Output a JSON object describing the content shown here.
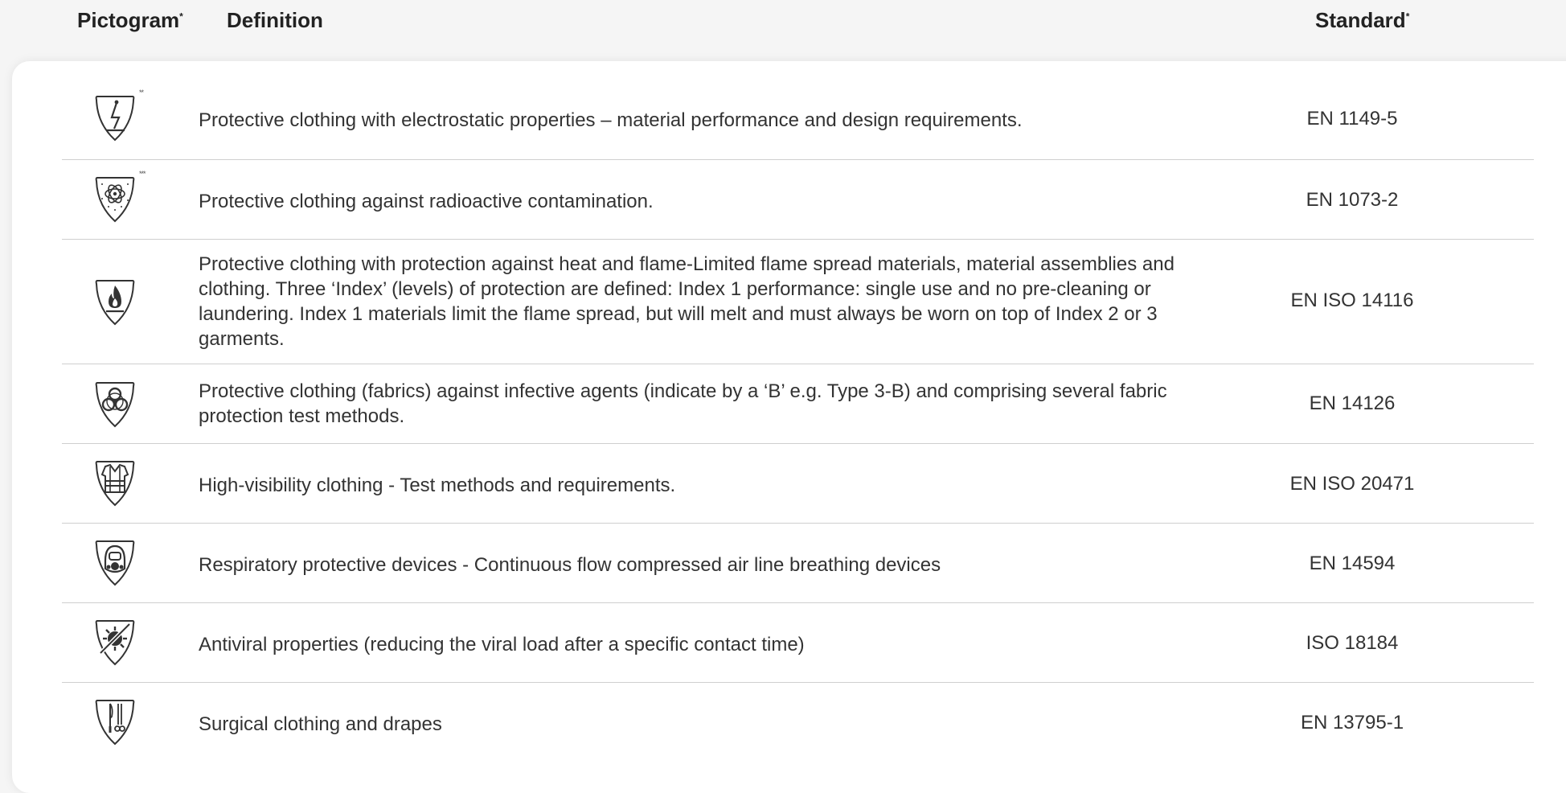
{
  "header": {
    "pictogram_label": "Pictogram",
    "pictogram_mark": "*",
    "definition_label": "Definition",
    "standard_label": "Standard",
    "standard_mark": "*"
  },
  "rows": [
    {
      "icon": "electrostatic-shield-icon",
      "stars": "**",
      "definition": "Protective clothing with electrostatic properties – material performance and design requirements.",
      "standard": "EN 1149-5"
    },
    {
      "icon": "radioactive-contamination-shield-icon",
      "stars": "***",
      "definition": "Protective clothing against radioactive contamination.",
      "standard": "EN 1073-2"
    },
    {
      "icon": "flame-shield-icon",
      "stars": "",
      "definition": "Protective clothing with protection against heat and flame-Limited flame spread materials, material assemblies and clothing. Three ‘Index’ (levels) of protection are defined: Index 1 performance: single use and no pre-cleaning or laundering. Index 1 materials limit the flame spread, but will melt and must always be worn on top of Index 2 or 3 garments.",
      "standard": "EN ISO 14116"
    },
    {
      "icon": "biohazard-shield-icon",
      "stars": "",
      "definition": "Protective clothing (fabrics) against infective agents (indicate by a ‘B’ e.g. Type 3-B) and comprising several fabric protection test methods.",
      "standard": "EN 14126"
    },
    {
      "icon": "high-visibility-vest-shield-icon",
      "stars": "",
      "definition": "High-visibility clothing - Test methods and requirements.",
      "standard": "EN ISO 20471"
    },
    {
      "icon": "respirator-shield-icon",
      "stars": "",
      "definition": "Respiratory protective devices - Continuous flow compressed air line breathing devices",
      "standard": "EN 14594"
    },
    {
      "icon": "antiviral-shield-icon",
      "stars": "",
      "definition": "Antiviral properties (reducing the viral load after a specific contact time)",
      "standard": "ISO 18184"
    },
    {
      "icon": "surgical-tools-shield-icon",
      "stars": "",
      "definition": "Surgical clothing and drapes",
      "standard": "EN 13795-1"
    }
  ]
}
